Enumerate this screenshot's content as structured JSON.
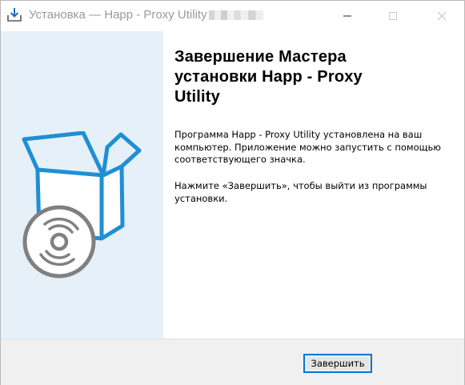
{
  "window": {
    "title": "Установка — Happ - Proxy Utility",
    "installer_icon": "download-tray-icon",
    "controls": [
      "minimize-icon",
      "maximize-icon",
      "close-icon"
    ]
  },
  "sidebar": {
    "image": "software-box-with-disc-icon",
    "background": "#e6f0f9",
    "accent": "#1f8fd4",
    "disc_color": "#808080"
  },
  "main": {
    "heading": "Завершение Мастера\nустановки Happ - Proxy\nUtility",
    "paragraph1": "Программа Happ - Proxy Utility установлена на ваш\nкомпьютер. Приложение можно запустить с помощью\nсоответствующего значка.",
    "paragraph2": "Нажмите «Завершить», чтобы выйти из программы\nустановки."
  },
  "footer": {
    "finish_label": "Завершить",
    "focus_color": "#0078d7"
  }
}
